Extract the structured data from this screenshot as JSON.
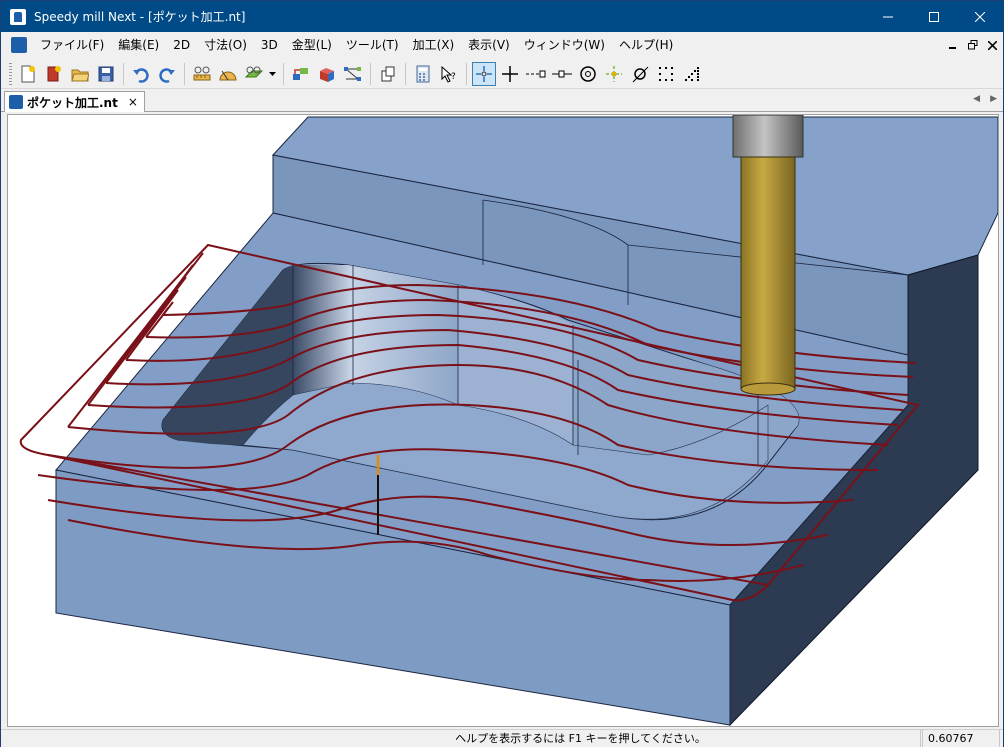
{
  "window": {
    "title": "Speedy mill Next - [ポケット加工.nt]"
  },
  "menu": {
    "items": [
      "ファイル(F)",
      "編集(E)",
      "2D",
      "寸法(O)",
      "3D",
      "金型(L)",
      "ツール(T)",
      "加工(X)",
      "表示(V)",
      "ウィンドウ(W)",
      "ヘルプ(H)"
    ]
  },
  "toolbar": {
    "icons": [
      "new-file-icon",
      "new-project-icon",
      "open-folder-icon",
      "save-icon",
      "undo-icon",
      "redo-icon",
      "measure-distance-icon",
      "measure-angle-icon",
      "measure-surface-icon",
      "dropdown-arrow-icon",
      "layer-icon",
      "solid-color-icon",
      "node-connect-icon",
      "copy-icon",
      "calculator-icon",
      "select-query-icon",
      "snap-free-icon",
      "snap-cross-icon",
      "snap-endpoint-icon",
      "snap-midpoint-icon",
      "snap-center-icon",
      "snap-intersection-icon",
      "snap-tangent-icon",
      "snap-grid-icon",
      "snap-pattern-icon"
    ]
  },
  "document": {
    "tab_label": "ポケット加工.nt",
    "close_label": "×"
  },
  "status": {
    "message": "ヘルプを表示するには F1 キーを押してください。",
    "value": "0.60767"
  },
  "colors": {
    "title_bar": "#004b87",
    "toolpath": "#7a1018",
    "solid_face": "#7f9cc6",
    "tool_body": "#b89a3a"
  }
}
